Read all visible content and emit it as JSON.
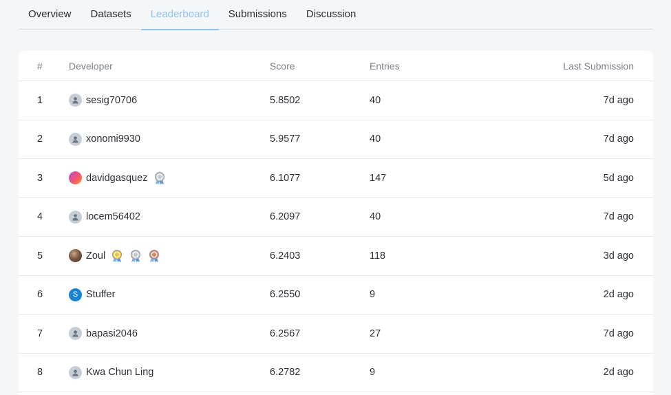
{
  "tabs": [
    "Overview",
    "Datasets",
    "Leaderboard",
    "Submissions",
    "Discussion"
  ],
  "active_tab": "Leaderboard",
  "table": {
    "headers": {
      "rank": "#",
      "developer": "Developer",
      "score": "Score",
      "entries": "Entries",
      "last": "Last Submission"
    },
    "rows": [
      {
        "rank": "1",
        "name": "sesig70706",
        "score": "5.8502",
        "entries": "40",
        "last": "7d ago",
        "avatar": "default",
        "medals": []
      },
      {
        "rank": "2",
        "name": "xonomi9930",
        "score": "5.9577",
        "entries": "40",
        "last": "7d ago",
        "avatar": "default",
        "medals": []
      },
      {
        "rank": "3",
        "name": "davidgasquez",
        "score": "6.1077",
        "entries": "147",
        "last": "5d ago",
        "avatar": "gradient",
        "medals": [
          "silver-medal-icon"
        ]
      },
      {
        "rank": "4",
        "name": "locem56402",
        "score": "6.2097",
        "entries": "40",
        "last": "7d ago",
        "avatar": "default",
        "medals": []
      },
      {
        "rank": "5",
        "name": "Zoul",
        "score": "6.2403",
        "entries": "118",
        "last": "3d ago",
        "avatar": "photo",
        "medals": [
          "gold-medal-icon",
          "silver-medal-icon",
          "bronze-medal-icon"
        ]
      },
      {
        "rank": "6",
        "name": "Stuffer",
        "score": "6.2550",
        "entries": "9",
        "last": "2d ago",
        "avatar": "letter",
        "avatar_letter": "S",
        "medals": []
      },
      {
        "rank": "7",
        "name": "bapasi2046",
        "score": "6.2567",
        "entries": "27",
        "last": "7d ago",
        "avatar": "default",
        "medals": []
      },
      {
        "rank": "8",
        "name": "Kwa Chun Ling",
        "score": "6.2782",
        "entries": "9",
        "last": "2d ago",
        "avatar": "default",
        "medals": []
      }
    ]
  },
  "colors": {
    "active_tab": "#8ec5f2",
    "medal_gold": "#f0c43a",
    "medal_silver": "#c7ccd3",
    "medal_bronze": "#d9866b"
  }
}
